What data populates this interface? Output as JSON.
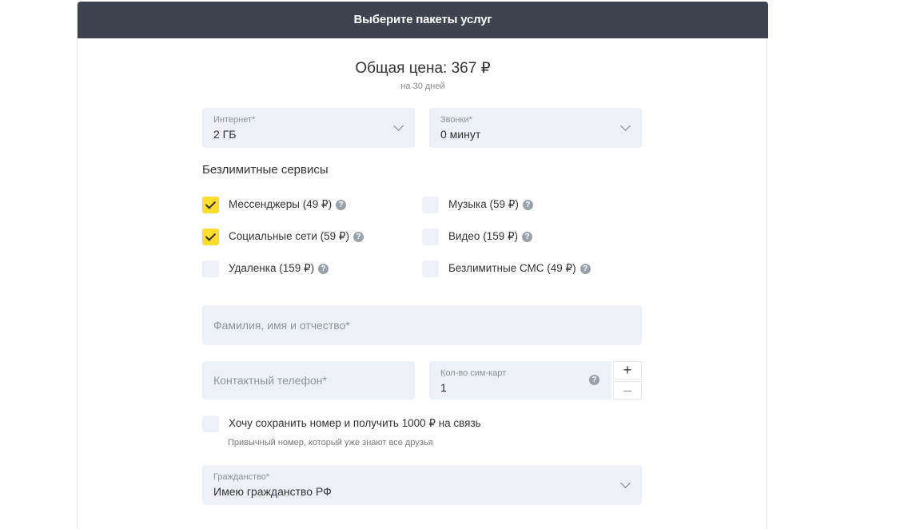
{
  "header": {
    "title": "Выберите пакеты услуг"
  },
  "summary": {
    "total_label": "Общая цена: 367 ₽",
    "period": "на 30 дней"
  },
  "internet": {
    "label": "Интернет*",
    "value": "2 ГБ"
  },
  "calls": {
    "label": "Звонки*",
    "value": "0 минут"
  },
  "unlimited": {
    "title": "Безлимитные сервисы",
    "items": [
      {
        "label": "Мессенджеры (49 ₽)",
        "checked": true
      },
      {
        "label": "Социальные сети (59 ₽)",
        "checked": true
      },
      {
        "label": "Удаленка (159 ₽)",
        "checked": false
      },
      {
        "label": "Музыка (59 ₽)",
        "checked": false
      },
      {
        "label": "Видео (159 ₽)",
        "checked": false
      },
      {
        "label": "Безлимитные СМС (49 ₽)",
        "checked": false
      }
    ]
  },
  "full_name": {
    "placeholder": "Фамилия, имя и отчество*"
  },
  "phone": {
    "placeholder": "Контактный телефон*"
  },
  "sim_count": {
    "label": "Кол-во сим-карт",
    "value": "1",
    "plus": "+",
    "minus": "–"
  },
  "keep_number": {
    "label": "Хочу сохранить номер и получить 1000 ₽ на связь",
    "note": "Привычный номер, который уже знают все друзья",
    "checked": false
  },
  "citizenship": {
    "label": "Гражданство*",
    "value": "Имею гражданство РФ"
  },
  "icons": {
    "help": "?"
  },
  "colors": {
    "header_bg": "#3f434f",
    "field_bg": "#edf0f7",
    "accent_yellow": "#ffdd2d"
  }
}
